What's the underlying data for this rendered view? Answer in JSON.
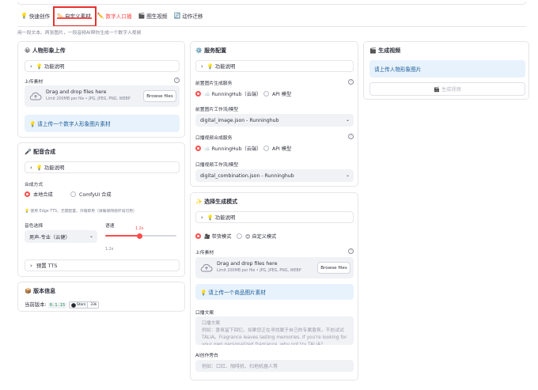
{
  "tabs": [
    {
      "icon": "💡",
      "label": "快速创作"
    },
    {
      "icon": "🏷️",
      "label": "自定义素材"
    },
    {
      "icon": "✏️",
      "label": "数字人口播"
    },
    {
      "icon": "🎬",
      "label": "图生视频"
    },
    {
      "icon": "🔄",
      "label": "动作迁移"
    }
  ],
  "subtitle": "用一段文本、两张图片，一段音频AI帮你生成一个数字人视频",
  "avatar_card": {
    "title": "😀 人物形象上传",
    "expander": "💡 功能说明",
    "upload_label": "上传素材",
    "upload_main": "Drag and drop files here",
    "upload_sub": "Limit 200MB per file • JPG, JPEG, PNG, WEBP",
    "browse": "Browse files",
    "info": "💡 请上传一个数字人形象图片素材"
  },
  "dub_card": {
    "title": "🎤 配音合成",
    "expander": "💡 功能说明",
    "method_label": "合成方式",
    "method_local": "本地合成",
    "method_comfy": "ComfyUI 合成",
    "method_caption": "💡 使用 Edge TTS，无需配置，开箱即用（请确保网络环境可用）",
    "voice_label": "音色选择",
    "voice_value": "男声-专业（云健）",
    "speed_label": "语速",
    "speed_value": "1.2x",
    "speed_min": "1.2x",
    "speed_fraction": 0.48,
    "preset_expander": "预置 TTS"
  },
  "version_card": {
    "title": "📦 版本信息",
    "current_label": "当前版本:",
    "version": "0.1.15",
    "stars_label": "Stars",
    "stars_count": "33k"
  },
  "service_card": {
    "title": "⚙️ 服务配置",
    "expander": "💡 功能说明",
    "pre_service_label": "前置图片生成服务",
    "pre_opt1": "☁️ RunningHub（云端）",
    "pre_opt2": "API 模型",
    "pre_workflow_label": "前置图片工作流/模型",
    "pre_workflow_value": "digital_image.json - Runninghub",
    "combo_service_label": "口播视频合成服务",
    "combo_opt1": "☁️ RunningHub（云端）",
    "combo_opt2": "API 模型",
    "combo_workflow_label": "口播视频工作流/模型",
    "combo_workflow_value": "digital_combination.json - Runninghub"
  },
  "mode_card": {
    "title": "✨ 选择生成模式",
    "expander": "💡 功能说明",
    "mode_opt1": "🎥 带货模式",
    "mode_opt2": "😊 自定义模式",
    "upload_label": "上传素材",
    "upload_main": "Drag and drop files here",
    "upload_sub": "Limit 200MB per file • JPG, JPEG, PNG, WEBP",
    "browse": "Browse files",
    "info": "💡 请上传一个商品图片素材",
    "script_label": "口播文案",
    "script_placeholder": "口播文案\n例如：香氛留下回忆。如果您正在寻找属于自己的专属香氛，不妨试试 TALIA。Fragrance leaves lasting memories. If you're looking for your own personalized fragrance, why not try TALIA?",
    "ai_label": "AI创作旁白",
    "ai_placeholder": "例如：口红、咖啡机、扫地机器人等"
  },
  "generate_card": {
    "title": "🎬 生成视频",
    "info": "请上传人物形象图片",
    "button": "🎬 生成视频"
  },
  "colors": {
    "accent": "#ff4b4b",
    "info_bg": "#e8f2fc",
    "info_text": "#1c5d99",
    "highlight_box": "#e8302c"
  }
}
